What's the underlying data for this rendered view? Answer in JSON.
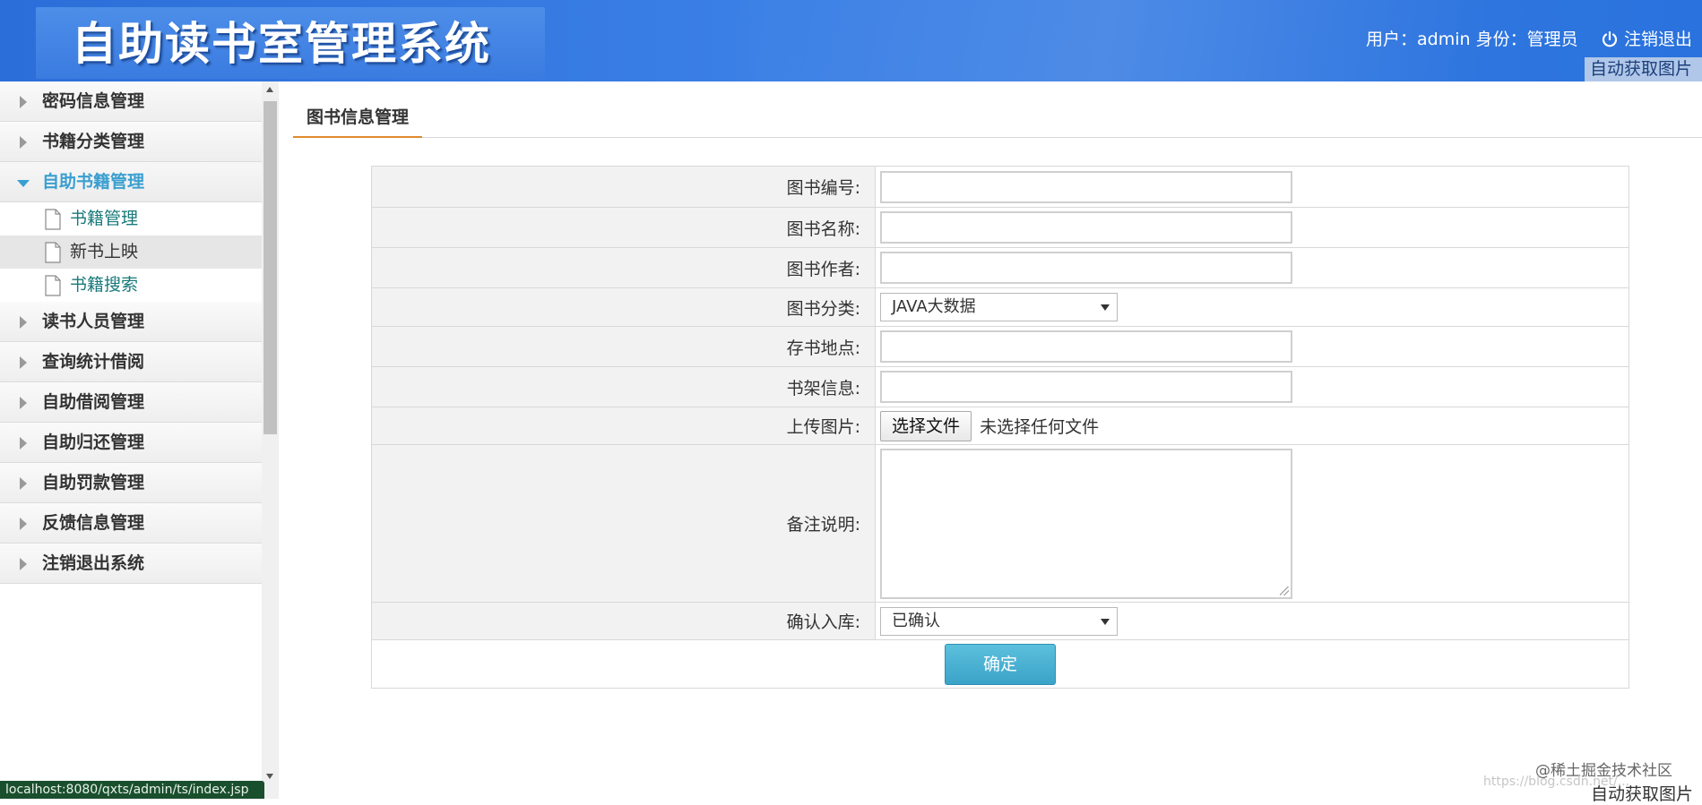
{
  "header": {
    "title": "自助读书室管理系统",
    "user_info": "用户：admin 身份：管理员",
    "logout_label": "注销退出",
    "auto_fetch_label": "自动获取图片"
  },
  "sidebar": {
    "items": [
      {
        "label": "密码信息管理"
      },
      {
        "label": "书籍分类管理"
      },
      {
        "label": "自助书籍管理",
        "open": true,
        "children": [
          "书籍管理",
          "新书上映",
          "书籍搜索"
        ]
      },
      {
        "label": "读书人员管理"
      },
      {
        "label": "查询统计借阅"
      },
      {
        "label": "自助借阅管理"
      },
      {
        "label": "自助归还管理"
      },
      {
        "label": "自助罚款管理"
      },
      {
        "label": "反馈信息管理"
      },
      {
        "label": "注销退出系统"
      }
    ],
    "active_child": "新书上映"
  },
  "status_bar": {
    "url": "localhost:8080/qxts/admin/ts/index.jsp"
  },
  "main": {
    "tab_label": "图书信息管理",
    "form": {
      "book_no_label": "图书编号:",
      "book_no_value": "",
      "book_name_label": "图书名称:",
      "book_name_value": "",
      "author_label": "图书作者:",
      "author_value": "",
      "category_label": "图书分类:",
      "category_value": "JAVA大数据",
      "location_label": "存书地点:",
      "location_value": "",
      "shelf_label": "书架信息:",
      "shelf_value": "",
      "upload_label": "上传图片:",
      "upload_button": "选择文件",
      "upload_status": "未选择任何文件",
      "remark_label": "备注说明:",
      "confirm_label": "确认入库:",
      "confirm_value": "已确认",
      "submit_label": "确定"
    }
  },
  "watermark": {
    "text": "@稀土掘金技术社区",
    "url": "https://blog.csdn.net/..."
  },
  "footer": {
    "auto_fetch_label": "自动获取图片"
  },
  "colors": {
    "header_blue": "#3b80e6",
    "sidebar_open": "#3a9fd0",
    "tab_underline": "#e08a2e",
    "submit_button": "#3ba3c8",
    "sub_item_link": "#1a7a7a"
  }
}
